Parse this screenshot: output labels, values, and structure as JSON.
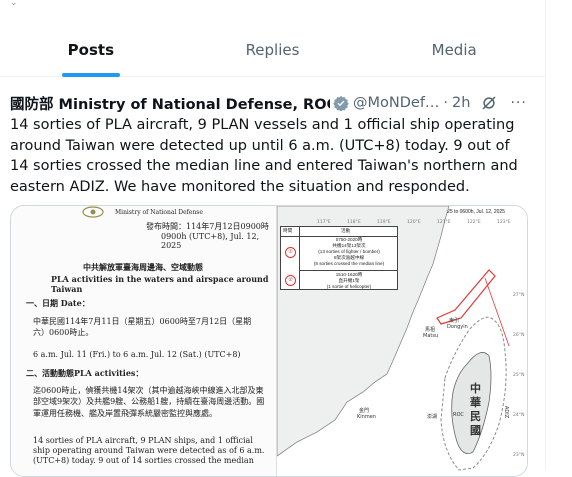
{
  "tabs": [
    {
      "label": "Posts",
      "active": true
    },
    {
      "label": "Replies",
      "active": false
    },
    {
      "label": "Media",
      "active": false
    }
  ],
  "post": {
    "author": "國防部 Ministry of National Defense, ROC(T…",
    "handle": "@MoNDef…",
    "separator": "·",
    "time": "2h",
    "more": "···",
    "text": "14 sorties of PLA aircraft, 9 PLAN vessels and 1 official ship operating around Taiwan were detected up until 6 a.m. (UTC+8) today. 9 out of 14 sorties crossed the median line and entered Taiwan's northern and eastern ADIZ. We have monitored the situation and responded."
  },
  "doc": {
    "ministry": "Ministry of National Defense",
    "date_line1": "發布時間：114年7月12日0900時",
    "date_line2": "0900h (UTC+8), Jul. 12, 2025",
    "title_zh": "中共解放軍臺海周邊海、空域動態",
    "title_en": "PLA activities in the waters and airspace around Taiwan",
    "section1": "一、日期 Date：",
    "date_zh": "中華民國114年7月11日（星期五）0600時至7月12日（星期六）0600時止。",
    "date_en": "6 a.m. Jul. 11 (Fri.) to 6 a.m. Jul. 12 (Sat.) (UTC+8)",
    "section2": "二、活動動態PLA activities：",
    "activity_zh": "迄0600時止，偵獲共機14架次（其中逾越海峽中線進入北部及東部空域9架次）及共艦9艘、公務船1艘，持續在臺海周邊活動。國軍運用任務機、艦及岸置飛彈系統嚴密監控與應處。",
    "activity_en": "14 sorties of PLA aircraft, 9 PLAN ships, and 1 official ship operating around Taiwan were detected as of 6 a.m. (UTC+8) today. 9 out of 14 sorties crossed the median"
  },
  "map": {
    "info": "Info. Time: 0600h, Jul. 11, 2025 to 0600h, Jul. 12, 2025",
    "legend_header_time": "時間",
    "legend_header_activity": "活動",
    "row1_mark": "①",
    "row1_lines": [
      "0750-2020時",
      "共機14架13架次",
      "(13 sorties of fighter / bomber)",
      "8架次逾越中線",
      "(8 sorties crossed the median line)"
    ],
    "row2_mark": "②",
    "row2_lines": [
      "1510-1620時",
      "直升機1架",
      "(1 sortie of helicopter)"
    ],
    "lon_labels": [
      "117°E",
      "118°E",
      "119°E",
      "120°E",
      "121°E",
      "122°E",
      "123°E"
    ],
    "lat_labels": [
      "27°N",
      "26°N",
      "25°N",
      "24°N",
      "23°N"
    ],
    "place_matsu": "馬祖\nMatsu",
    "place_dongyin": "東引\nDongyin",
    "place_kinmen": "金門\nKinmen",
    "place_penghu": "澎湖",
    "roc_zh": "中\n華\n民\n國",
    "roc_en": "ROC",
    "adiz": "ADIZ",
    "pla": "中共",
    "colors": {
      "track": "#e53935",
      "adiz": "#8a8a8a",
      "accent": "#1d9bf0"
    }
  }
}
